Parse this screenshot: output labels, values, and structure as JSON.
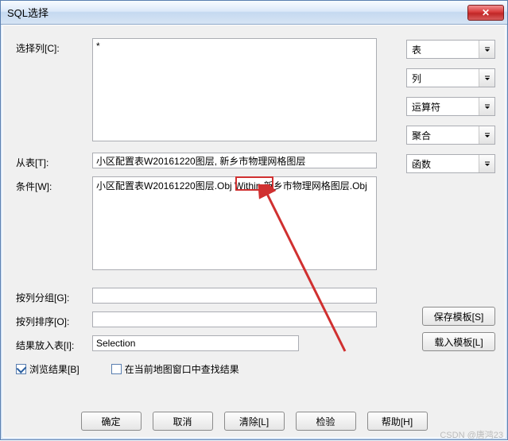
{
  "window": {
    "title": "SQL选择"
  },
  "labels": {
    "selectCol": "选择列[C]:",
    "fromTable": "从表[T]:",
    "where": "条件[W]:",
    "groupBy": "按列分组[G]:",
    "orderBy": "按列排序[O]:",
    "intoTable": "结果放入表[I]:",
    "browseResult": "浏览结果[B]",
    "findInCurrent": "在当前地图窗口中查找结果"
  },
  "fields": {
    "selectCol": "*",
    "fromTable": "小区配置表W20161220图层, 新乡市物理网格图层",
    "where": "小区配置表W20161220图层.Obj Within 新乡市物理网格图层.Obj",
    "groupBy": "",
    "orderBy": "",
    "intoTable": "Selection"
  },
  "right": {
    "table": "表",
    "column": "列",
    "operator": "运算符",
    "aggregate": "聚合",
    "function": "函数"
  },
  "buttons": {
    "saveTpl": "保存模板[S]",
    "loadTpl": "载入模板[L]",
    "ok": "确定",
    "cancel": "取消",
    "clear": "清除[L]",
    "verify": "检验",
    "help": "帮助[H]"
  },
  "checks": {
    "browse": true,
    "findInCurrent": false
  },
  "watermark": "CSDN @唐鸿23"
}
